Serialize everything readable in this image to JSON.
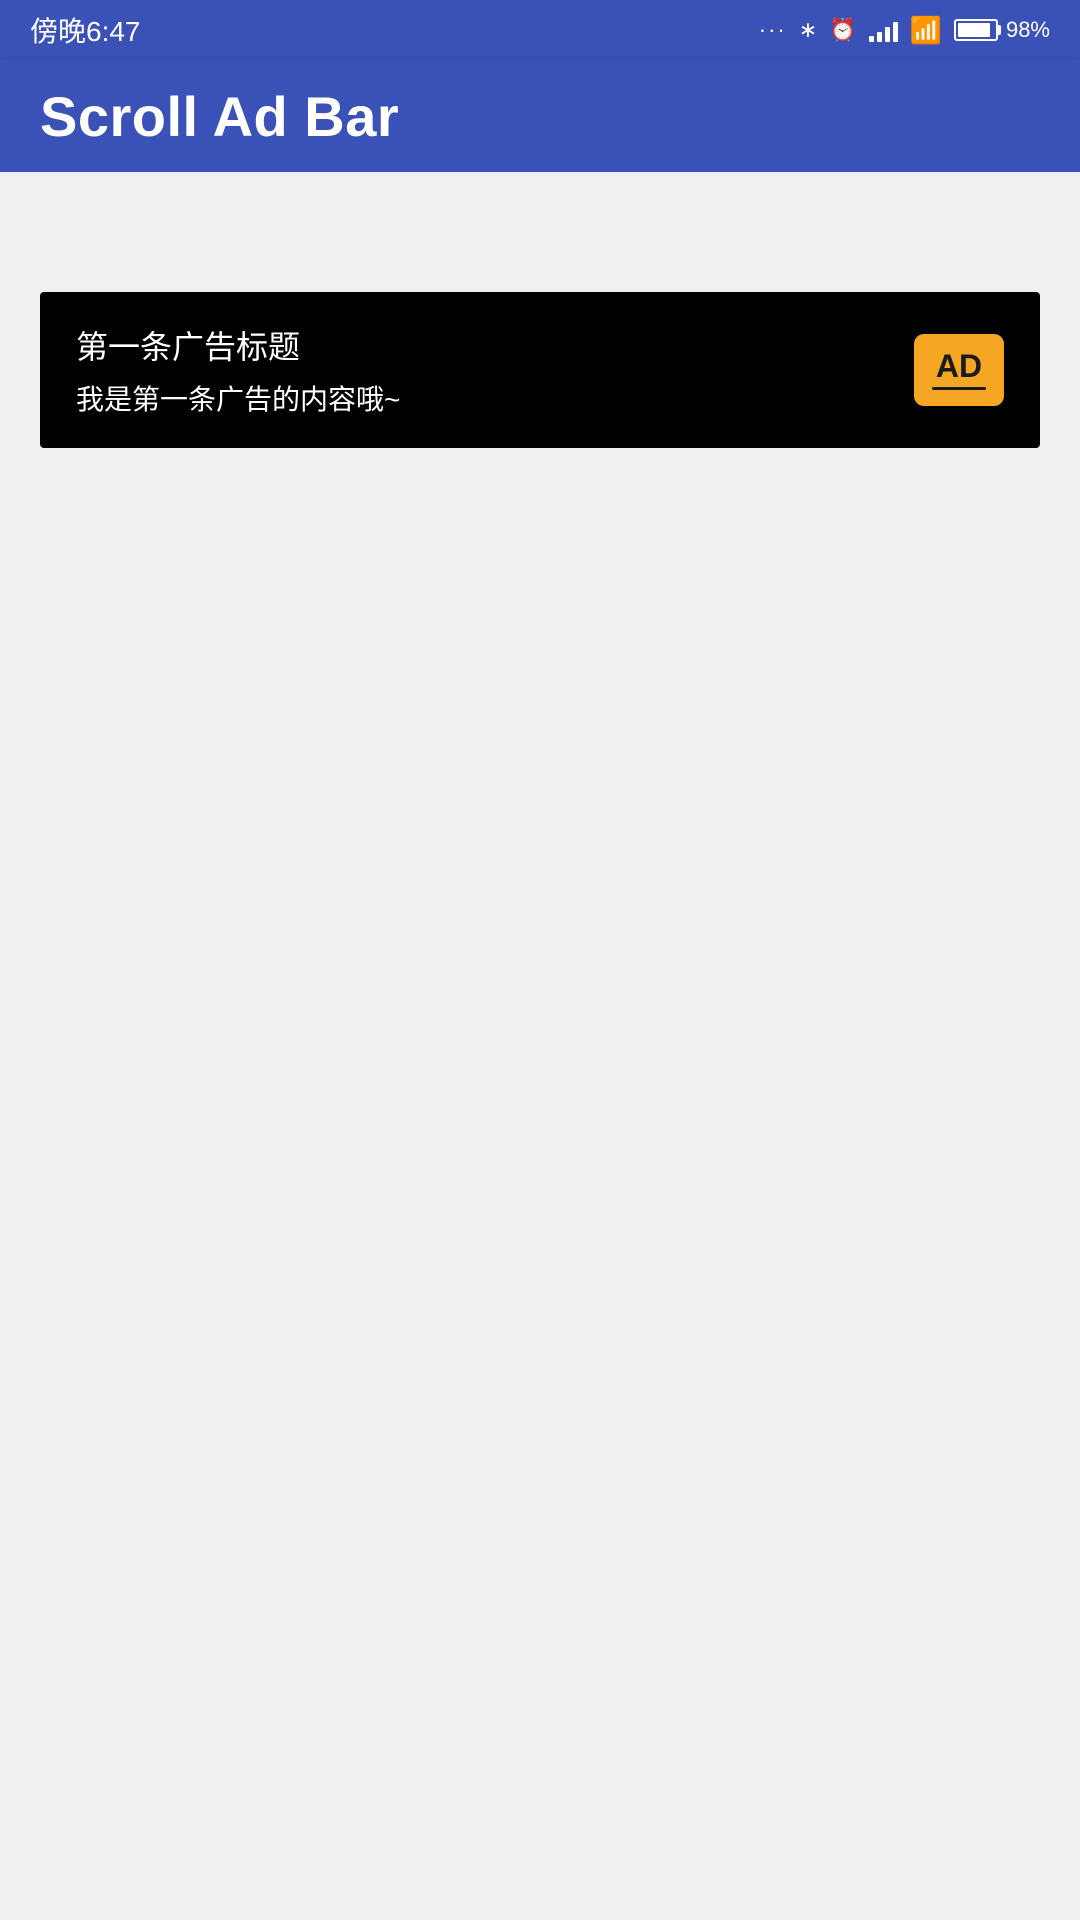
{
  "statusBar": {
    "time": "傍晚6:47",
    "batteryPercent": "98%",
    "signals": [
      1,
      2,
      3,
      4
    ]
  },
  "appBar": {
    "title": "Scroll Ad Bar"
  },
  "adBanner": {
    "title": "第一条广告标题",
    "content": "我是第一条广告的内容哦~",
    "badgeText": "AD"
  }
}
